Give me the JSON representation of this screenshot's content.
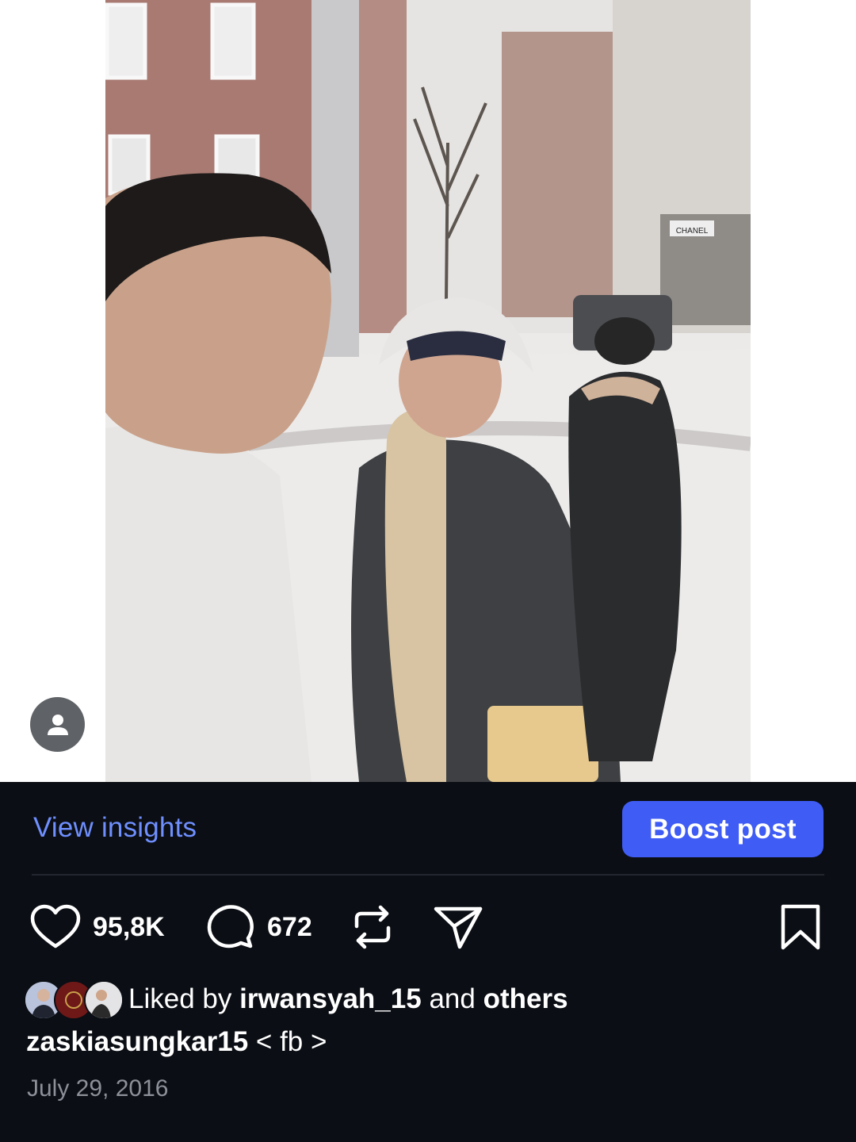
{
  "post": {
    "photo_alt": "Couple taking a selfie on a snowy city street",
    "store_sign": "CHANEL"
  },
  "actions": {
    "view_insights": "View insights",
    "boost_post": "Boost post"
  },
  "stats": {
    "likes": "95,8K",
    "comments": "672"
  },
  "liked_by": {
    "prefix": "Liked by",
    "user": "irwansyah_15",
    "connector": "and",
    "suffix": "others"
  },
  "caption": {
    "username": "zaskiasungkar15",
    "text": "< fb >"
  },
  "date": "July 29, 2016",
  "colors": {
    "background": "#0b0e14",
    "link": "#6f8fff",
    "boost_button": "#3f5cf5",
    "muted_text": "#8d9099"
  },
  "icons": [
    "user-tag-icon",
    "heart-icon",
    "comment-icon",
    "repost-icon",
    "share-icon",
    "bookmark-icon"
  ]
}
